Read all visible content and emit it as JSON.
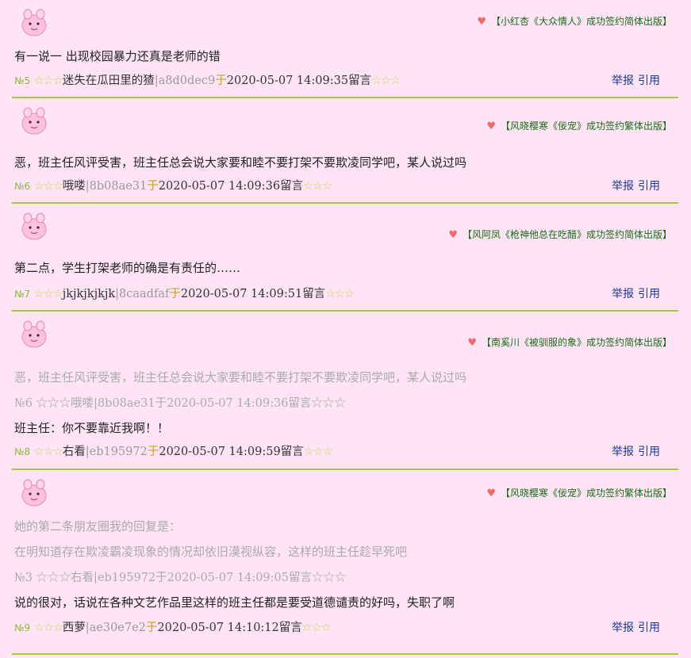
{
  "posts": [
    {
      "ad": "【小红杏《大众情人》成功签约简体出版】",
      "content": "有一说一 出现校园暴力还真是老师的错",
      "no": "№5",
      "stars_before": "☆☆☆",
      "user": "迷失在瓜田里的猹",
      "hash": "|a8d0dec9",
      "yu": "于",
      "time": "2020-05-07 14:09:35",
      "liuyan": "留言",
      "stars_after": "☆☆☆",
      "report": "举报",
      "cite": "引用"
    },
    {
      "ad": "【风晓樱寒《佞宠》成功签约繁体出版】",
      "content": "恶，班主任风评受害，班主任总会说大家要和睦不要打架不要欺凌同学吧，某人说过吗",
      "no": "№6",
      "stars_before": "☆☆☆",
      "user": "哦喽",
      "hash": "|8b08ae31",
      "yu": "于",
      "time": "2020-05-07 14:09:36",
      "liuyan": "留言",
      "stars_after": "☆☆☆",
      "report": "举报",
      "cite": "引用"
    },
    {
      "ad": "【风阿凤《枪神他总在吃醋》成功签约简体出版】",
      "content": "第二点，学生打架老师的确是有责任的……",
      "no": "№7",
      "stars_before": "☆☆☆",
      "user": "jkjkjkjkjk",
      "hash": "|8caadfaf",
      "yu": "于",
      "time": "2020-05-07 14:09:51",
      "liuyan": "留言",
      "stars_after": "☆☆☆",
      "report": "举报",
      "cite": "引用"
    },
    {
      "ad": "【南奚川《被驯服的象》成功签约简体出版】",
      "quote_lines": [
        "恶，班主任风评受害，班主任总会说大家要和睦不要打架不要欺凌同学吧，某人说过吗"
      ],
      "quote_meta": "№6 ☆☆☆哦喽|8b08ae31于2020-05-07 14:09:36留言☆☆☆",
      "content": "班主任：你不要靠近我啊！！",
      "no": "№8",
      "stars_before": "☆☆☆",
      "user": "右看",
      "hash": "|eb195972",
      "yu": "于",
      "time": "2020-05-07 14:09:59",
      "liuyan": "留言",
      "stars_after": "☆☆☆",
      "report": "举报",
      "cite": "引用"
    },
    {
      "ad": "【风晓樱寒《佞宠》成功签约繁体出版】",
      "quote_lines": [
        "她的第二条朋友圈我的回复是：",
        "在明知道存在欺凌霸凌现象的情况却依旧漠视纵容，这样的班主任趁早死吧"
      ],
      "quote_meta": "№3 ☆☆☆右看|eb195972于2020-05-07 14:09:05留言☆☆☆",
      "content": "说的很对，话说在各种文艺作品里这样的班主任都是要受道德谴责的好吗，失职了啊",
      "no": "№9",
      "stars_before": "☆☆☆",
      "user": "西萝",
      "hash": "|ae30e7e2",
      "yu": "于",
      "time": "2020-05-07 14:10:12",
      "liuyan": "留言",
      "stars_after": "☆☆☆",
      "report": "举报",
      "cite": "引用"
    }
  ],
  "colors": {
    "background": "#ffe4f5",
    "divider": "#a6c93b",
    "ad_text": "#1a6b1a",
    "heart": "#ef6b6b",
    "link": "#1a3a9a"
  },
  "icons": {
    "avatar": "pink-creature-avatar-icon",
    "heart": "heart-icon"
  }
}
